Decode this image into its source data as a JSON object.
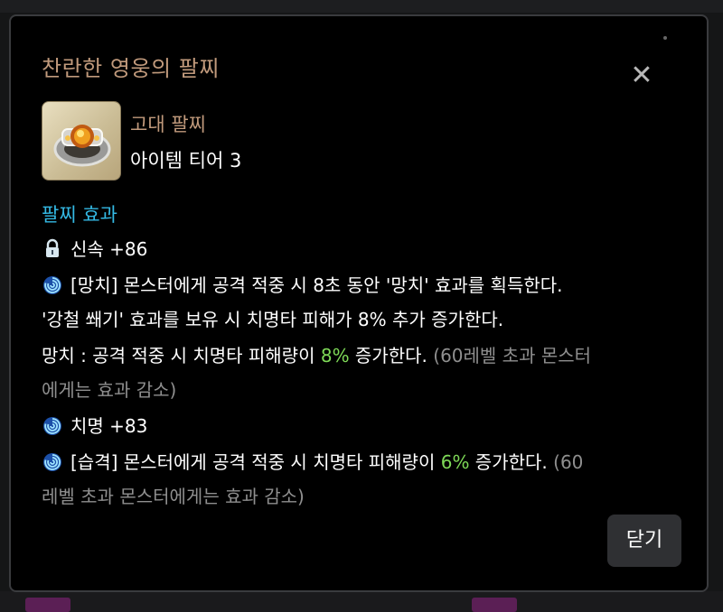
{
  "dialog": {
    "title": "찬란한 영웅의 팔찌",
    "close_icon": "close-icon",
    "close_button_label": "닫기"
  },
  "item": {
    "icon": "bracelet-icon",
    "grade": "고대 팔찌",
    "tier": "아이템 티어 3"
  },
  "effects": {
    "section_title": "팔찌 효과",
    "lines": [
      {
        "icon": "lock-icon",
        "text": "신속 +86"
      },
      {
        "icon": "swirl-icon",
        "text": "[망치] 몬스터에게 공격 적중 시 8초 동안 '망치' 효과를 획득한다."
      },
      {
        "text": "'강철 쐐기' 효과를 보유 시 치명타 피해가 8% 추가 증가한다."
      },
      {
        "prefix": "망치 : 공격 적중 시 치명타 피해량이 ",
        "highlight": "8%",
        "suffix": " 증가한다.",
        "note": " (60레벨 초과 몬스터"
      },
      {
        "note": "에게는 효과 감소)"
      },
      {
        "icon": "swirl-icon",
        "text": "치명 +83"
      },
      {
        "icon": "swirl-icon",
        "prefix": "[습격] 몬스터에게 공격 적중 시 치명타 피해량이 ",
        "highlight": "6%",
        "suffix": " 증가한다.",
        "note": " (60"
      },
      {
        "note": "레벨 초과 몬스터에게는 효과 감소)"
      }
    ]
  },
  "colors": {
    "title": "#c19a7c",
    "section": "#34b9e4",
    "highlight": "#7ed957",
    "note": "#8f8f8f",
    "panel": "#000000"
  }
}
